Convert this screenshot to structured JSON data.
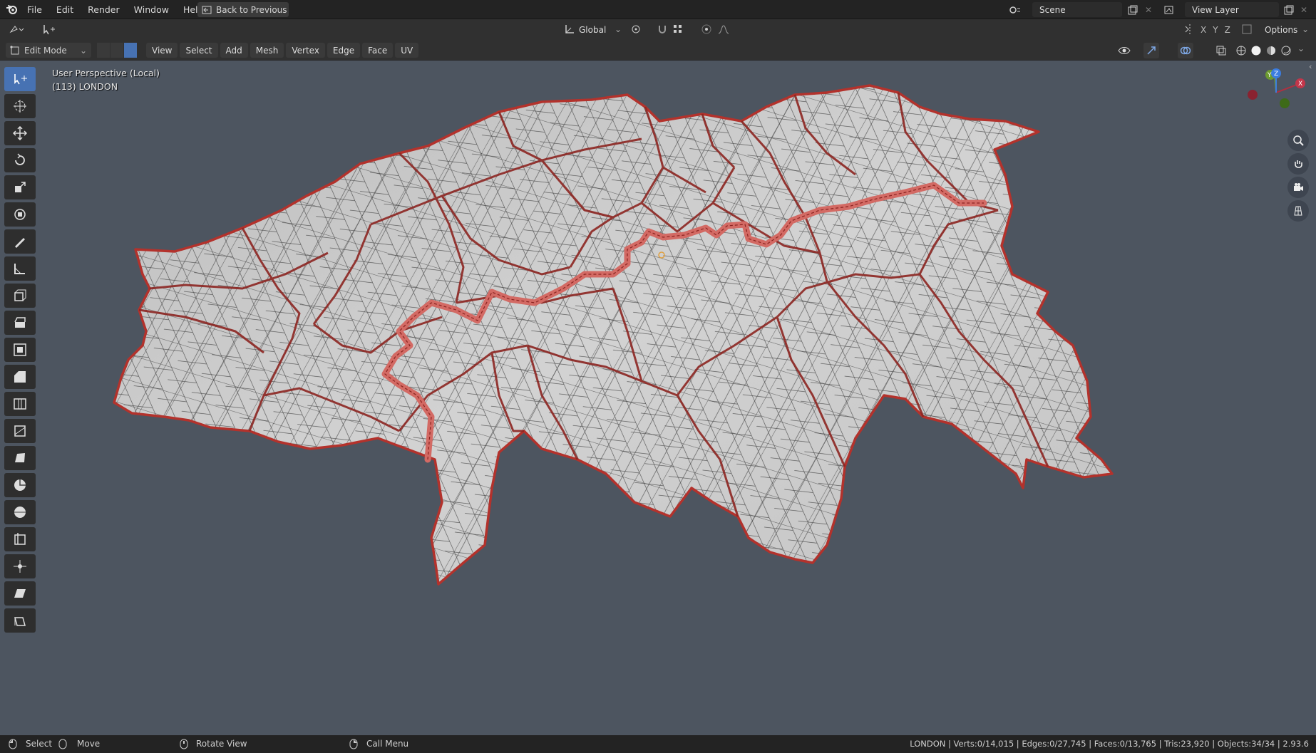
{
  "app": {
    "menu": [
      "File",
      "Edit",
      "Render",
      "Window",
      "Help"
    ],
    "back_button": "Back to Previous",
    "scene": "Scene",
    "view_layer": "View Layer"
  },
  "tool_header": {
    "transform_orientation": "Global",
    "axes": [
      "X",
      "Y",
      "Z"
    ],
    "options": "Options"
  },
  "header": {
    "mode": "Edit Mode",
    "menus": [
      "View",
      "Select",
      "Add",
      "Mesh",
      "Vertex",
      "Edge",
      "Face",
      "UV"
    ]
  },
  "viewport": {
    "perspective_label": "User Perspective (Local)",
    "object_label": "(113) LONDON",
    "gizmo_axes": [
      "Y",
      "Z",
      "X"
    ]
  },
  "statusbar": {
    "select": "Select",
    "move": "Move",
    "rotate_view": "Rotate View",
    "call_menu": "Call Menu",
    "stats": "LONDON | Verts:0/14,015 | Edges:0/27,745 | Faces:0/13,765 | Tris:23,920 | Objects:34/34 | 2.93.6"
  },
  "colors": {
    "viewport_bg": "#4d5560",
    "mesh_fill": "#c9c9c9",
    "boundary": "#b3322c",
    "river": "#d36a64",
    "active_tool": "#4772b3"
  },
  "toolbar_icons": [
    "select-box-icon",
    "cursor-icon",
    "move-icon",
    "rotate-icon",
    "scale-icon",
    "transform-icon",
    "annotate-icon",
    "measure-icon",
    "add-cube-icon",
    "extrude-icon",
    "inset-icon",
    "bevel-icon",
    "loop-cut-icon",
    "knife-icon",
    "poly-build-icon",
    "spin-icon",
    "smooth-icon",
    "edge-slide-icon",
    "shrink-fatten-icon",
    "shear-icon",
    "rip-icon"
  ]
}
